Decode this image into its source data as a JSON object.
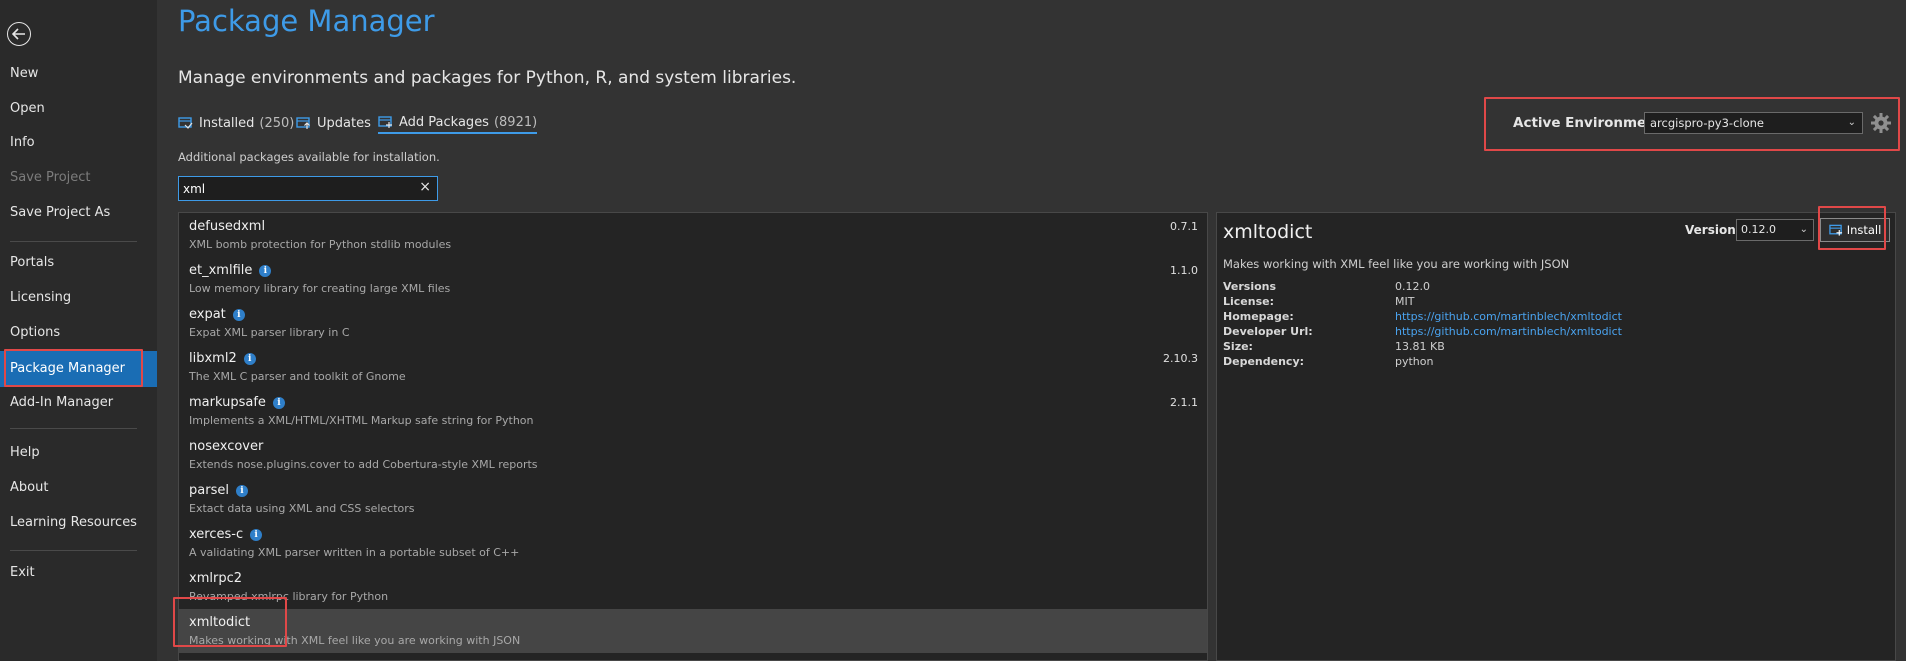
{
  "window": {
    "title": "Package Manager",
    "subtitle": "Manage environments and packages for Python, R, and system libraries."
  },
  "sidebar": {
    "items": [
      {
        "label": "New"
      },
      {
        "label": "Open"
      },
      {
        "label": "Info"
      },
      {
        "label": "Save Project",
        "disabled": true
      },
      {
        "label": "Save Project As"
      },
      {
        "label": "Portals"
      },
      {
        "label": "Licensing"
      },
      {
        "label": "Options"
      },
      {
        "label": "Package Manager",
        "active": true
      },
      {
        "label": "Add-In Manager"
      },
      {
        "label": "Help"
      },
      {
        "label": "About"
      },
      {
        "label": "Learning Resources"
      },
      {
        "label": "Exit"
      }
    ]
  },
  "tabs": [
    {
      "label": "Installed",
      "count": "(250)"
    },
    {
      "label": "Updates",
      "count": ""
    },
    {
      "label": "Add Packages",
      "count": "(8921)",
      "active": true
    }
  ],
  "additional_text": "Additional packages available for installation.",
  "search": {
    "value": "xml",
    "clear_icon": "×"
  },
  "packages": [
    {
      "name": "defusedxml",
      "info": false,
      "version": "0.7.1",
      "description": "XML bomb protection for Python stdlib modules"
    },
    {
      "name": "et_xmlfile",
      "info": true,
      "version": "1.1.0",
      "description": "Low memory library for creating large XML files"
    },
    {
      "name": "expat",
      "info": true,
      "version": "",
      "description": "Expat XML parser library in C"
    },
    {
      "name": "libxml2",
      "info": true,
      "version": "2.10.3",
      "description": "The XML C parser and toolkit of Gnome"
    },
    {
      "name": "markupsafe",
      "info": true,
      "version": "2.1.1",
      "description": "Implements a XML/HTML/XHTML Markup safe string for Python"
    },
    {
      "name": "nosexcover",
      "info": false,
      "version": "",
      "description": "Extends nose.plugins.cover to add Cobertura-style XML reports"
    },
    {
      "name": "parsel",
      "info": true,
      "version": "",
      "description": "Extact data using XML and CSS selectors"
    },
    {
      "name": "xerces-c",
      "info": true,
      "version": "",
      "description": "A validating XML parser written in a portable subset of C++"
    },
    {
      "name": "xmlrpc2",
      "info": false,
      "version": "",
      "description": "Revamped xmlrpc library for Python"
    },
    {
      "name": "xmltodict",
      "info": false,
      "version": "",
      "description": "Makes working with XML feel like you are working with JSON",
      "selected": true
    }
  ],
  "detail": {
    "name": "xmltodict",
    "description": "Makes working with XML feel like you are working with JSON",
    "version_label": "Version:",
    "version_value": "0.12.0",
    "install_label": "Install",
    "fields": [
      {
        "label": "Versions",
        "value": "0.12.0",
        "link": false
      },
      {
        "label": "License:",
        "value": "MIT",
        "link": false
      },
      {
        "label": "Homepage:",
        "value": "https://github.com/martinblech/xmltodict",
        "link": true
      },
      {
        "label": "Developer Url:",
        "value": "https://github.com/martinblech/xmltodict",
        "link": true
      },
      {
        "label": "Size:",
        "value": "13.81 KB",
        "link": false
      },
      {
        "label": "Dependency:",
        "value": "python",
        "link": false
      }
    ]
  },
  "environment": {
    "label": "Active Environment",
    "value": "arcgispro-py3-clone"
  },
  "colors": {
    "accent": "#3e9be8",
    "highlight": "#e04848",
    "active_nav": "#1a6db4",
    "link": "#4aa3ef"
  }
}
